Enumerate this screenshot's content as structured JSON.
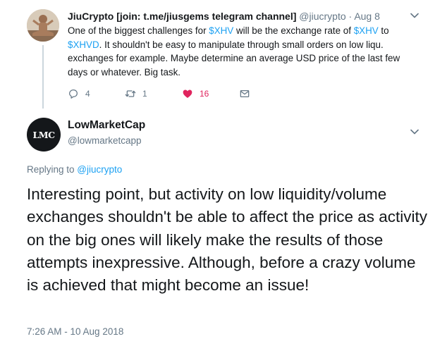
{
  "parent_tweet": {
    "display_name": "JiuCrypto [join: t.me/jiusgems telegram channel]",
    "handle": "@jiucrypto",
    "separator": " · ",
    "date": "Aug 8",
    "text_segments": [
      {
        "text": "One of the biggest challenges for ",
        "type": "text"
      },
      {
        "text": "$XHV",
        "type": "cashtag"
      },
      {
        "text": " will be the exchange rate of ",
        "type": "text"
      },
      {
        "text": "$XHV",
        "type": "cashtag"
      },
      {
        "text": " to ",
        "type": "text"
      },
      {
        "text": "$XHVD",
        "type": "cashtag"
      },
      {
        "text": ". It shouldn't be easy to manipulate through small orders on low liqu. exchanges for example. Maybe determine an average USD price of the last few days or whatever. Big task.",
        "type": "text"
      }
    ],
    "reply_count": "4",
    "retweet_count": "1",
    "like_count": "16"
  },
  "main_tweet": {
    "avatar_text": "LMC",
    "display_name": "LowMarketCap",
    "handle": "@lowmarketcapp",
    "replying_prefix": "Replying to ",
    "replying_to": "@jiucrypto",
    "text": "Interesting point, but activity on low liquidity/volume exchanges shouldn't be able to affect the price as activity on the big ones will likely make the results of those attempts inexpressive. Although, before a crazy volume is achieved that might become an issue!",
    "timestamp": "7:26 AM - 10 Aug 2018"
  },
  "colors": {
    "link": "#1da1f2",
    "like": "#e0245e",
    "muted": "#657786",
    "text": "#14171a"
  },
  "icons": [
    "reply-icon",
    "retweet-icon",
    "heart-icon",
    "direct-message-icon",
    "chevron-down-icon"
  ]
}
